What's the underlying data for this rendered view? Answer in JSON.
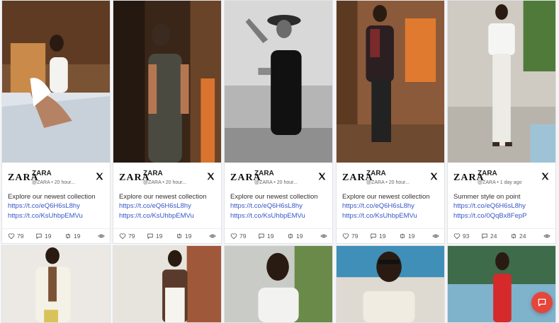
{
  "posts": [
    {
      "brand": "ZARA",
      "name": "ZARA",
      "handle": "@ZARA",
      "time": "20 hour...",
      "text": "Explore our newest collection",
      "link1": "https://t.co/eQ6H6sL8hy",
      "link2": "https://t.co/KsUhbpEMVu",
      "likes": "79",
      "replies": "19",
      "retweets": "19"
    },
    {
      "brand": "ZARA",
      "name": "ZARA",
      "handle": "@ZARA",
      "time": "20 hour...",
      "text": "Explore our newest collection",
      "link1": "https://t.co/eQ6H6sL8hy",
      "link2": "https://t.co/KsUhbpEMVu",
      "likes": "79",
      "replies": "19",
      "retweets": "19"
    },
    {
      "brand": "ZARA",
      "name": "ZARA",
      "handle": "@ZARA",
      "time": "20 hour...",
      "text": "Explore our newest collection",
      "link1": "https://t.co/eQ6H6sL8hy",
      "link2": "https://t.co/KsUhbpEMVu",
      "likes": "79",
      "replies": "19",
      "retweets": "19"
    },
    {
      "brand": "ZARA",
      "name": "ZARA",
      "handle": "@ZARA",
      "time": "20 hour...",
      "text": "Explore our newest collection",
      "link1": "https://t.co/eQ6H6sL8hy",
      "link2": "https://t.co/KsUhbpEMVu",
      "likes": "79",
      "replies": "19",
      "retweets": "19"
    },
    {
      "brand": "ZARA",
      "name": "ZARA",
      "handle": "@ZARA",
      "time": "1 day ago",
      "text": "Summer style on point",
      "link1": "https://t.co/eQ6H6sL8hy",
      "link2": "https://t.co/0QqBx8FepP",
      "likes": "93",
      "replies": "24",
      "retweets": "24"
    }
  ],
  "colors": {
    "link": "#3557c9",
    "chat_button": "#e6453a"
  },
  "icons": {
    "platform": "x-logo-icon",
    "like": "heart-icon",
    "reply": "comment-icon",
    "retweet": "retweet-icon",
    "views": "eye-icon",
    "chat": "chat-icon"
  }
}
